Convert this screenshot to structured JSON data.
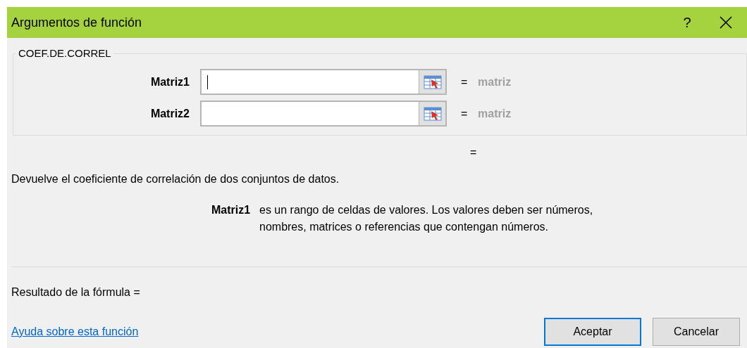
{
  "window": {
    "title": "Argumentos de función",
    "help": "?"
  },
  "function_name": "COEF.DE.CORREL",
  "arguments": [
    {
      "label": "Matriz1",
      "focused": true,
      "equals": "=",
      "result": "matriz"
    },
    {
      "label": "Matriz2",
      "focused": false,
      "equals": "=",
      "result": "matriz"
    }
  ],
  "function_result": "=",
  "description": "Devuelve el coeficiente de correlación de dos conjuntos de datos.",
  "argument_help": {
    "name": "Matriz1",
    "text": "es un rango de celdas de valores. Los valores deben ser números, nombres, matrices o referencias que contengan números."
  },
  "formula_result": "Resultado de la fórmula =",
  "help_link": "Ayuda sobre esta función",
  "buttons": [
    {
      "label": "Aceptar",
      "default": true
    },
    {
      "label": "Cancelar",
      "default": false
    }
  ]
}
